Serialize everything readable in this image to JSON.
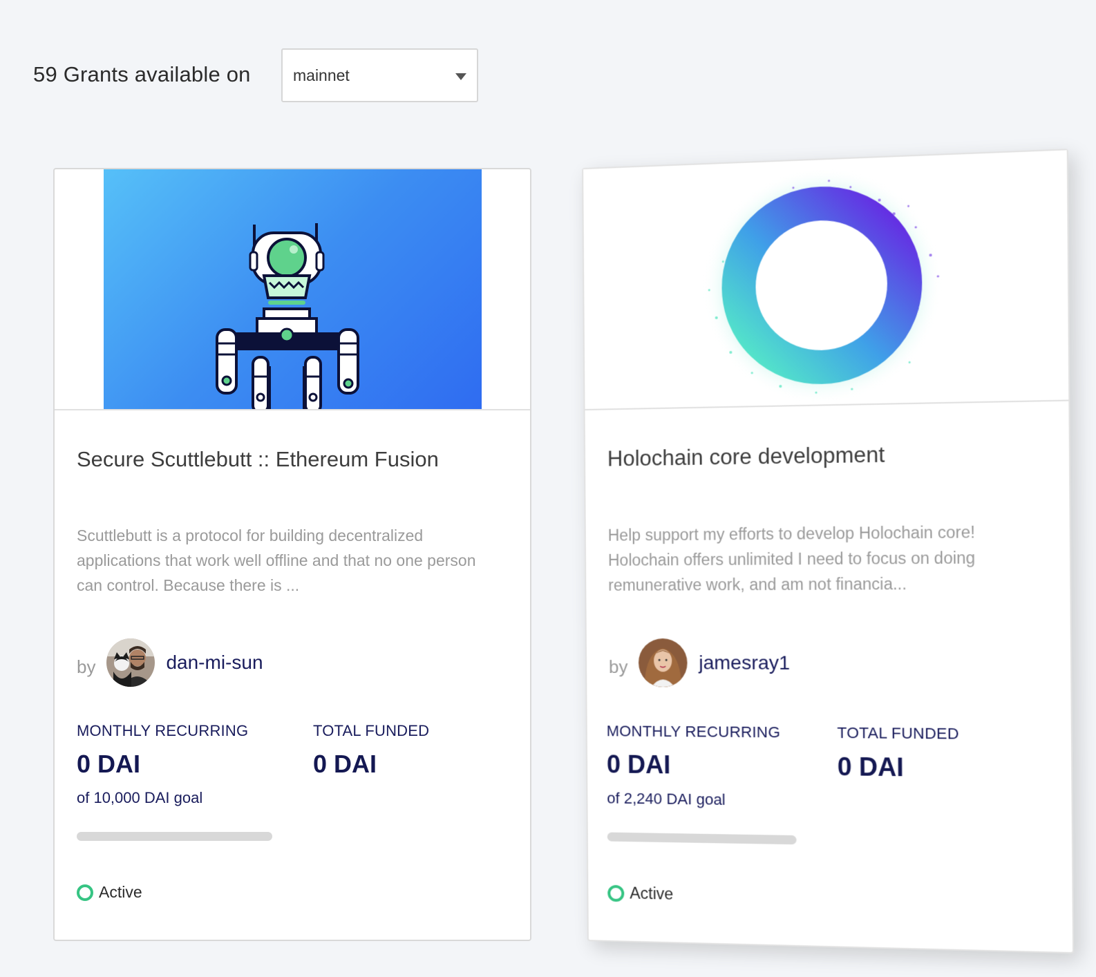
{
  "header": {
    "grants_text": "59 Grants available on",
    "network_selected": "mainnet"
  },
  "grants": [
    {
      "title": "Secure Scuttlebutt :: Ethereum Fusion",
      "description": "Scuttlebutt is a protocol for building decentralized applications that work well offline and that no one person can control. Because there is ...",
      "by_label": "by",
      "author": "dan-mi-sun",
      "monthly_label": "MONTHLY RECURRING",
      "monthly_value": "0 DAI",
      "goal_text": "of 10,000 DAI goal",
      "total_label": "TOTAL FUNDED",
      "total_value": "0 DAI",
      "progress": 0,
      "status": "Active"
    },
    {
      "title": "Holochain core development",
      "description": "Help support my efforts to develop Holochain core! Holochain offers unlimited I need to focus on doing remunerative work, and am not financia...",
      "by_label": "by",
      "author": "jamesray1",
      "monthly_label": "MONTHLY RECURRING",
      "monthly_value": "0 DAI",
      "goal_text": "of 2,240 DAI goal",
      "total_label": "TOTAL FUNDED",
      "total_value": "0 DAI",
      "progress": 0,
      "status": "Active"
    }
  ]
}
